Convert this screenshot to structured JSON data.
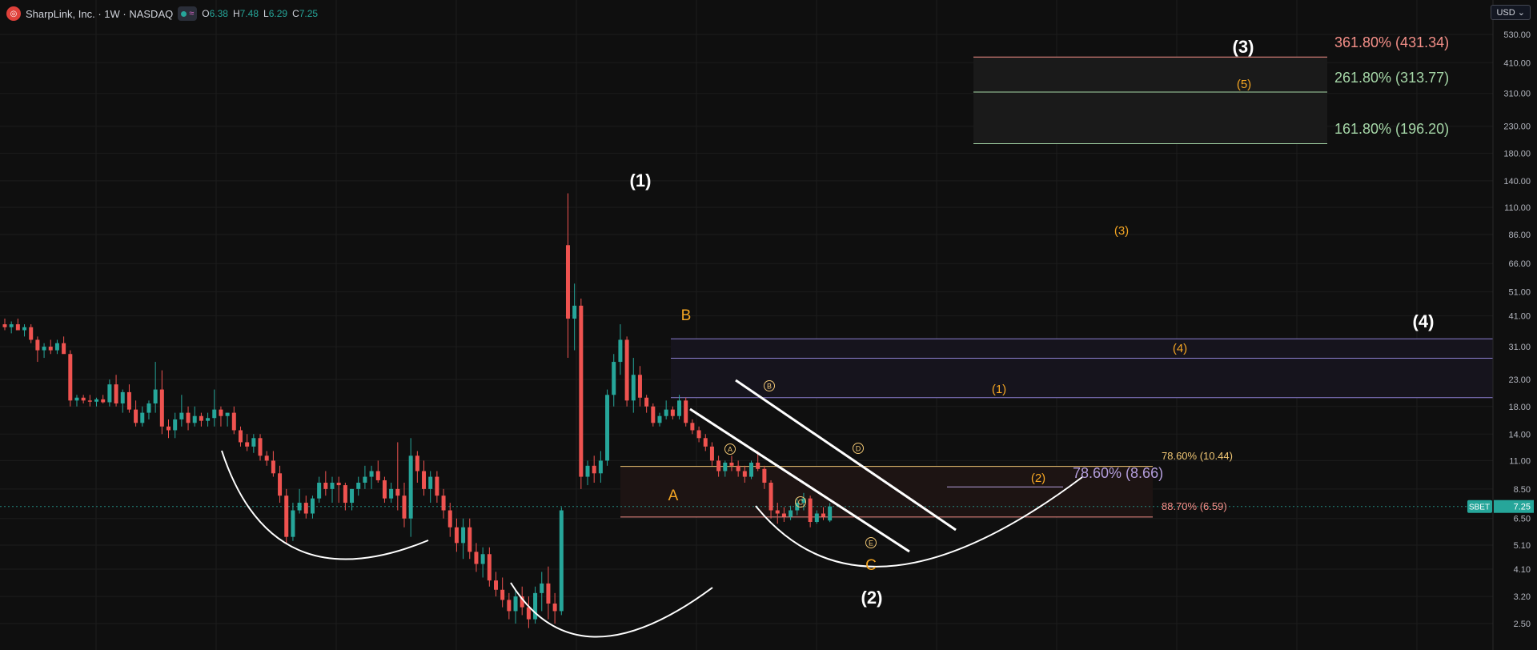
{
  "header": {
    "title": "SharpLink, Inc. · 1W · NASDAQ",
    "ohlc": [
      {
        "key": "O",
        "value": "6.38"
      },
      {
        "key": "H",
        "value": "7.48"
      },
      {
        "key": "L",
        "value": "6.29"
      },
      {
        "key": "C",
        "value": "7.25"
      }
    ]
  },
  "currency": "USD",
  "colors": {
    "up": "#26a69a",
    "down": "#ef5350",
    "orange": "#f5a623",
    "white": "#ffffff",
    "purple": "#b39ddb",
    "fib_red": "#f48f88",
    "fib_green": "#a5d6a7",
    "fib_yellow": "#f0c674"
  },
  "chart_data": {
    "type": "candlestick",
    "symbol": "SBET",
    "timeframe": "1W",
    "y_scale": "log",
    "y_ticks": [
      "530.00",
      "410.00",
      "310.00",
      "230.00",
      "180.00",
      "140.00",
      "110.00",
      "86.00",
      "66.00",
      "51.00",
      "41.00",
      "31.00",
      "23.00",
      "18.00",
      "14.00",
      "11.00",
      "8.50",
      "6.50",
      "5.10",
      "4.10",
      "3.20",
      "2.50"
    ],
    "last_price": {
      "label": "SBET",
      "value": "7.25"
    },
    "wave_labels": [
      {
        "text": "(1)",
        "kind": "white-major"
      },
      {
        "text": "(2)",
        "kind": "white-major"
      },
      {
        "text": "(3)",
        "kind": "white-major"
      },
      {
        "text": "(4)",
        "kind": "white-major"
      },
      {
        "text": "A",
        "kind": "orange-abc"
      },
      {
        "text": "B",
        "kind": "orange-abc"
      },
      {
        "text": "C",
        "kind": "orange-abc"
      },
      {
        "text": "(1)",
        "kind": "orange-minor"
      },
      {
        "text": "(2)",
        "kind": "orange-minor"
      },
      {
        "text": "(3)",
        "kind": "orange-minor"
      },
      {
        "text": "(4)",
        "kind": "orange-minor"
      },
      {
        "text": "(5)",
        "kind": "orange-minor"
      },
      {
        "text": "B",
        "kind": "circled"
      },
      {
        "text": "A",
        "kind": "circled"
      },
      {
        "text": "C",
        "kind": "circled"
      },
      {
        "text": "D",
        "kind": "circled"
      },
      {
        "text": "E",
        "kind": "circled"
      }
    ],
    "fib_levels": [
      {
        "text": "361.80% (431.34)",
        "price": 431.34,
        "kind": "fib_red"
      },
      {
        "text": "261.80% (313.77)",
        "price": 313.77,
        "kind": "fib_green"
      },
      {
        "text": "161.80% (196.20)",
        "price": 196.2,
        "kind": "fib_green"
      },
      {
        "text": "78.60% (10.44)",
        "price": 10.44,
        "kind": "fib_yellow"
      },
      {
        "text": "88.70% (6.59)",
        "price": 6.59,
        "kind": "fib_red"
      },
      {
        "text": "78.60% (8.66)",
        "price": 8.66,
        "kind": "purple"
      }
    ],
    "resistance_levels": [
      33.3,
      27.9,
      19.5
    ],
    "candles": [
      {
        "o": 38,
        "h": 40,
        "l": 36,
        "c": 37
      },
      {
        "o": 37,
        "h": 39,
        "l": 35,
        "c": 38
      },
      {
        "o": 38,
        "h": 40,
        "l": 36,
        "c": 36
      },
      {
        "o": 36,
        "h": 38,
        "l": 34,
        "c": 37
      },
      {
        "o": 37,
        "h": 38,
        "l": 32,
        "c": 33
      },
      {
        "o": 33,
        "h": 34,
        "l": 27,
        "c": 30
      },
      {
        "o": 30,
        "h": 32,
        "l": 28,
        "c": 31
      },
      {
        "o": 31,
        "h": 33,
        "l": 29,
        "c": 30
      },
      {
        "o": 30,
        "h": 33,
        "l": 29,
        "c": 32
      },
      {
        "o": 32,
        "h": 34,
        "l": 30,
        "c": 29
      },
      {
        "o": 29,
        "h": 30,
        "l": 18,
        "c": 19
      },
      {
        "o": 19,
        "h": 20,
        "l": 18,
        "c": 19.5
      },
      {
        "o": 19.5,
        "h": 20,
        "l": 18.5,
        "c": 19
      },
      {
        "o": 19,
        "h": 20,
        "l": 18,
        "c": 18.8
      },
      {
        "o": 18.8,
        "h": 19.5,
        "l": 18,
        "c": 19.2
      },
      {
        "o": 19.2,
        "h": 20,
        "l": 18.5,
        "c": 18.7
      },
      {
        "o": 18.7,
        "h": 23,
        "l": 18,
        "c": 22
      },
      {
        "o": 22,
        "h": 24,
        "l": 18,
        "c": 18.5
      },
      {
        "o": 18.5,
        "h": 21,
        "l": 17,
        "c": 20.5
      },
      {
        "o": 20.5,
        "h": 22,
        "l": 17,
        "c": 17.5
      },
      {
        "o": 17.5,
        "h": 19,
        "l": 15,
        "c": 15.5
      },
      {
        "o": 15.5,
        "h": 18,
        "l": 15,
        "c": 17
      },
      {
        "o": 17,
        "h": 19,
        "l": 16,
        "c": 18.5
      },
      {
        "o": 18.5,
        "h": 27,
        "l": 17,
        "c": 21
      },
      {
        "o": 21,
        "h": 25,
        "l": 14,
        "c": 15
      },
      {
        "o": 15,
        "h": 16,
        "l": 13.5,
        "c": 14.5
      },
      {
        "o": 14.5,
        "h": 17,
        "l": 13.5,
        "c": 16
      },
      {
        "o": 16,
        "h": 20,
        "l": 15,
        "c": 17
      },
      {
        "o": 17,
        "h": 18,
        "l": 14.5,
        "c": 15.5
      },
      {
        "o": 15.5,
        "h": 18,
        "l": 15,
        "c": 16.5
      },
      {
        "o": 16.5,
        "h": 17,
        "l": 15,
        "c": 15.8
      },
      {
        "o": 15.8,
        "h": 17,
        "l": 15,
        "c": 16.2
      },
      {
        "o": 16.2,
        "h": 21,
        "l": 15,
        "c": 17.5
      },
      {
        "o": 17.5,
        "h": 18,
        "l": 15,
        "c": 16.5
      },
      {
        "o": 16.5,
        "h": 17,
        "l": 15,
        "c": 17
      },
      {
        "o": 17,
        "h": 18,
        "l": 14,
        "c": 14.5
      },
      {
        "o": 14.5,
        "h": 15,
        "l": 12.5,
        "c": 13
      },
      {
        "o": 13,
        "h": 14,
        "l": 12,
        "c": 12.5
      },
      {
        "o": 12.5,
        "h": 14,
        "l": 11.8,
        "c": 13.5
      },
      {
        "o": 13.5,
        "h": 14,
        "l": 11,
        "c": 11.5
      },
      {
        "o": 11.5,
        "h": 12,
        "l": 10.5,
        "c": 11
      },
      {
        "o": 11,
        "h": 12,
        "l": 9.5,
        "c": 9.8
      },
      {
        "o": 9.8,
        "h": 10.5,
        "l": 7.5,
        "c": 8
      },
      {
        "o": 8,
        "h": 8.5,
        "l": 5.2,
        "c": 5.5
      },
      {
        "o": 5.5,
        "h": 7.5,
        "l": 5.3,
        "c": 7
      },
      {
        "o": 7,
        "h": 8.5,
        "l": 6.8,
        "c": 7.5
      },
      {
        "o": 7.5,
        "h": 8,
        "l": 6.5,
        "c": 6.8
      },
      {
        "o": 6.8,
        "h": 8,
        "l": 6.5,
        "c": 7.8
      },
      {
        "o": 7.8,
        "h": 9.5,
        "l": 7.5,
        "c": 9
      },
      {
        "o": 9,
        "h": 10,
        "l": 8,
        "c": 8.5
      },
      {
        "o": 8.5,
        "h": 9.5,
        "l": 7.5,
        "c": 9
      },
      {
        "o": 9,
        "h": 9.5,
        "l": 7.5,
        "c": 8.8
      },
      {
        "o": 8.8,
        "h": 9,
        "l": 7,
        "c": 7.5
      },
      {
        "o": 7.5,
        "h": 8.5,
        "l": 7,
        "c": 8.5
      },
      {
        "o": 8.5,
        "h": 9.5,
        "l": 8,
        "c": 9
      },
      {
        "o": 9,
        "h": 10.5,
        "l": 8.5,
        "c": 9.5
      },
      {
        "o": 9.5,
        "h": 10.5,
        "l": 8.5,
        "c": 10
      },
      {
        "o": 10,
        "h": 11,
        "l": 9,
        "c": 9.2
      },
      {
        "o": 9.2,
        "h": 9.5,
        "l": 7.5,
        "c": 7.8
      },
      {
        "o": 7.8,
        "h": 9,
        "l": 7.5,
        "c": 8.5
      },
      {
        "o": 8.5,
        "h": 13,
        "l": 7,
        "c": 8
      },
      {
        "o": 8,
        "h": 9,
        "l": 6,
        "c": 6.5
      },
      {
        "o": 6.5,
        "h": 13.5,
        "l": 5.5,
        "c": 11.5
      },
      {
        "o": 11.5,
        "h": 12,
        "l": 9,
        "c": 10
      },
      {
        "o": 10,
        "h": 11,
        "l": 8,
        "c": 8.5
      },
      {
        "o": 8.5,
        "h": 10,
        "l": 7.5,
        "c": 9.5
      },
      {
        "o": 9.5,
        "h": 10,
        "l": 7.5,
        "c": 8
      },
      {
        "o": 8,
        "h": 8.5,
        "l": 6.5,
        "c": 7
      },
      {
        "o": 7,
        "h": 7.5,
        "l": 5.5,
        "c": 6
      },
      {
        "o": 6,
        "h": 6.5,
        "l": 4.8,
        "c": 5.2
      },
      {
        "o": 5.2,
        "h": 6.5,
        "l": 4.5,
        "c": 6
      },
      {
        "o": 6,
        "h": 6.5,
        "l": 4.5,
        "c": 4.8
      },
      {
        "o": 4.8,
        "h": 5.2,
        "l": 4,
        "c": 4.3
      },
      {
        "o": 4.3,
        "h": 5,
        "l": 3.8,
        "c": 4.7
      },
      {
        "o": 4.7,
        "h": 5,
        "l": 3.5,
        "c": 3.7
      },
      {
        "o": 3.7,
        "h": 4,
        "l": 3.2,
        "c": 3.4
      },
      {
        "o": 3.4,
        "h": 3.8,
        "l": 2.9,
        "c": 3.1
      },
      {
        "o": 3.1,
        "h": 3.3,
        "l": 2.6,
        "c": 2.8
      },
      {
        "o": 2.8,
        "h": 3.4,
        "l": 2.5,
        "c": 3.2
      },
      {
        "o": 3.2,
        "h": 3.5,
        "l": 2.7,
        "c": 2.9
      },
      {
        "o": 2.9,
        "h": 3.2,
        "l": 2.4,
        "c": 2.6
      },
      {
        "o": 2.6,
        "h": 3.5,
        "l": 2.5,
        "c": 3.3
      },
      {
        "o": 3.3,
        "h": 4,
        "l": 2.8,
        "c": 3.6
      },
      {
        "o": 3.6,
        "h": 4.2,
        "l": 2.6,
        "c": 3
      },
      {
        "o": 3,
        "h": 3.3,
        "l": 2.5,
        "c": 2.8
      },
      {
        "o": 2.8,
        "h": 7.2,
        "l": 2.7,
        "c": 7
      },
      {
        "o": 78,
        "h": 125,
        "l": 28,
        "c": 40
      },
      {
        "o": 40,
        "h": 55,
        "l": 30,
        "c": 45
      },
      {
        "o": 45,
        "h": 48,
        "l": 8.5,
        "c": 9.5
      },
      {
        "o": 9.5,
        "h": 11,
        "l": 8.8,
        "c": 10.5
      },
      {
        "o": 10.5,
        "h": 11.5,
        "l": 9,
        "c": 9.8
      },
      {
        "o": 9.8,
        "h": 12,
        "l": 9,
        "c": 11
      },
      {
        "o": 11,
        "h": 21,
        "l": 10.5,
        "c": 20
      },
      {
        "o": 20,
        "h": 29,
        "l": 18,
        "c": 27
      },
      {
        "o": 27,
        "h": 38,
        "l": 24,
        "c": 33
      },
      {
        "o": 33,
        "h": 34,
        "l": 18,
        "c": 19
      },
      {
        "o": 19,
        "h": 28,
        "l": 17,
        "c": 24
      },
      {
        "o": 24,
        "h": 26,
        "l": 18,
        "c": 19.5
      },
      {
        "o": 19.5,
        "h": 20,
        "l": 17,
        "c": 18
      },
      {
        "o": 18,
        "h": 18.5,
        "l": 15,
        "c": 15.5
      },
      {
        "o": 15.5,
        "h": 17,
        "l": 15,
        "c": 16.5
      },
      {
        "o": 16.5,
        "h": 19,
        "l": 16,
        "c": 17.5
      },
      {
        "o": 17.5,
        "h": 18,
        "l": 16,
        "c": 16.5
      },
      {
        "o": 16.5,
        "h": 20,
        "l": 16,
        "c": 19
      },
      {
        "o": 19,
        "h": 19.5,
        "l": 15,
        "c": 15.5
      },
      {
        "o": 15.5,
        "h": 16,
        "l": 14,
        "c": 14.5
      },
      {
        "o": 14.5,
        "h": 15,
        "l": 13,
        "c": 13.5
      },
      {
        "o": 13.5,
        "h": 14,
        "l": 12,
        "c": 12.5
      },
      {
        "o": 12.5,
        "h": 13,
        "l": 10.5,
        "c": 11
      },
      {
        "o": 11,
        "h": 11.5,
        "l": 9.5,
        "c": 10
      },
      {
        "o": 10,
        "h": 11,
        "l": 9.5,
        "c": 10.8
      },
      {
        "o": 10.8,
        "h": 11.5,
        "l": 10,
        "c": 10.5
      },
      {
        "o": 10.5,
        "h": 11,
        "l": 9.5,
        "c": 10
      },
      {
        "o": 10,
        "h": 10.5,
        "l": 9,
        "c": 9.5
      },
      {
        "o": 9.5,
        "h": 11,
        "l": 9.3,
        "c": 10.8
      },
      {
        "o": 10.8,
        "h": 12,
        "l": 10,
        "c": 10.2
      },
      {
        "o": 10.2,
        "h": 10.5,
        "l": 8.5,
        "c": 9
      },
      {
        "o": 9,
        "h": 9.2,
        "l": 6.5,
        "c": 7
      },
      {
        "o": 7,
        "h": 7.5,
        "l": 6.2,
        "c": 6.8
      },
      {
        "o": 6.8,
        "h": 7.2,
        "l": 6.3,
        "c": 6.6
      },
      {
        "o": 6.6,
        "h": 7.3,
        "l": 6.4,
        "c": 7
      },
      {
        "o": 7,
        "h": 7.8,
        "l": 6.7,
        "c": 7.5
      },
      {
        "o": 7.5,
        "h": 8.2,
        "l": 7,
        "c": 7.8
      },
      {
        "o": 7.8,
        "h": 8,
        "l": 6,
        "c": 6.3
      },
      {
        "o": 6.3,
        "h": 7,
        "l": 6.2,
        "c": 6.8
      },
      {
        "o": 6.8,
        "h": 7.2,
        "l": 6.4,
        "c": 6.6
      },
      {
        "o": 6.38,
        "h": 7.48,
        "l": 6.29,
        "c": 7.25
      }
    ]
  }
}
